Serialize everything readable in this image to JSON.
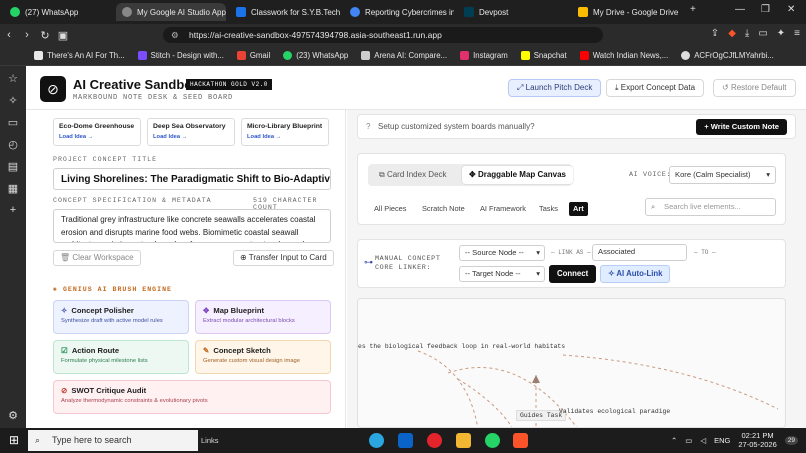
{
  "browser": {
    "tabs": [
      {
        "label": "(27) WhatsApp",
        "color": "#25d366",
        "active": false
      },
      {
        "label": "My Google AI Studio App",
        "color": "#888888",
        "active": true
      },
      {
        "label": "Classwork for S.Y.B.Tech (E",
        "color": "#1a73e8",
        "active": false
      },
      {
        "label": "Reporting Cybercrimes in",
        "color": "#4285f4",
        "active": false
      },
      {
        "label": "Devpost",
        "color": "#003e54",
        "active": false
      },
      {
        "label": "My Drive - Google Drive",
        "color": "#fbbc04",
        "active": false
      }
    ],
    "url": "https://ai-creative-sandbox-497574394798.asia-southeast1.run.app",
    "bookmarks": [
      {
        "label": "There's An AI For Th...",
        "color": "#e8e8e8"
      },
      {
        "label": "Stitch - Design with...",
        "color": "#7c4dff"
      },
      {
        "label": "Gmail",
        "color": "#ea4335"
      },
      {
        "label": "(23) WhatsApp",
        "color": "#25d366"
      },
      {
        "label": "Arena AI: Compare...",
        "color": "#cccccc"
      },
      {
        "label": "Instagram",
        "color": "#e1306c"
      },
      {
        "label": "Snapchat",
        "color": "#fffc00"
      },
      {
        "label": "Watch Indian News,...",
        "color": "#ff0000"
      },
      {
        "label": "ACFrOgCJfLMYahrbi...",
        "color": "#dddddd"
      }
    ]
  },
  "header": {
    "title": "AI Creative Sandbox",
    "badge": "HACKATHON GOLD V2.0",
    "subtitle": "MARKBOUND NOTE DESK & SEED BOARD",
    "launch_label": "Launch Pitch Deck",
    "export_label": "Export Concept Data",
    "restore_label": "Restore Default"
  },
  "left": {
    "seeds": [
      {
        "title": "Eco-Dome Greenhouse",
        "link": "Load Idea →"
      },
      {
        "title": "Deep Sea Observatory",
        "link": "Load Idea →"
      },
      {
        "title": "Micro-Library Blueprint",
        "link": "Load Idea →"
      }
    ],
    "title_label": "PROJECT CONCEPT TITLE",
    "title_value": "Living Shorelines: The Paradigmatic Shift to Bio-Adaptive Marine E",
    "spec_label": "CONCEPT SPECIFICATION & METADATA",
    "char_count": "519 CHARACTER COUNT",
    "spec_text": "Traditional grey infrastructure like concrete seawalls accelerates coastal erosion and disrupts marine food webs. Biomimetic coastal seawall architecture mimics natural coral reefs, mangrove root networks, and",
    "clear_label": "Clear Workspace",
    "transfer_label": "Transfer Input to Card",
    "engine_label": "GENIUS AI BRUSH ENGINE",
    "tools": [
      {
        "title": "Concept Polisher",
        "desc": "Synthesize draft with active model rules",
        "icon": "✧",
        "bg": "#eef2ff",
        "border": "#c9d4f7"
      },
      {
        "title": "Map Blueprint",
        "desc": "Extract modular architectural blocks",
        "icon": "✥",
        "bg": "#f6efff",
        "border": "#dcc8f3"
      },
      {
        "title": "Action Route",
        "desc": "Formulate physical milestone lists",
        "icon": "☑",
        "bg": "#ecf8f1",
        "border": "#bfe6cf"
      },
      {
        "title": "Concept Sketch",
        "desc": "Generate custom visual design image",
        "icon": "✎",
        "bg": "#fff5e8",
        "border": "#f2d8b0"
      },
      {
        "title": "SWOT Critique Audit",
        "desc": "Analyze thermodynamic constraints & evolutionary pivots",
        "icon": "⊘",
        "bg": "#fff0f1",
        "border": "#f3c9cf"
      }
    ]
  },
  "right": {
    "setup_text": "Setup customized system boards manually?",
    "write_label": "+ Write Custom Note",
    "view_tabs": [
      "Card Index Deck",
      "Draggable Map Canvas"
    ],
    "voice_label": "AI VOICE:",
    "voice_value": "Kore (Calm Specialist)",
    "filters": [
      "All Pieces",
      "Scratch Note",
      "AI Framework",
      "Tasks",
      "Art"
    ],
    "search_placeholder": "Search live elements...",
    "linker_label": "MANUAL CONCEPT CORE LINKER:",
    "source_node": "-- Source Node --",
    "link_as": "LINK AS",
    "link_value": "Associated",
    "to_label": "TO",
    "target_node": "-- Target Node --",
    "connect_label": "Connect",
    "autolink_label": "AI Auto-Link",
    "canvas_labels": [
      "es the biological feedback loop in real-world habitats",
      "Guides Task",
      "Validates ecological paradige"
    ]
  },
  "taskbar": {
    "search_placeholder": "Type here to search",
    "links_label": "Links",
    "lang": "ENG",
    "time": "02:21 PM",
    "date": "27-05-2026",
    "notif_count": "29"
  }
}
